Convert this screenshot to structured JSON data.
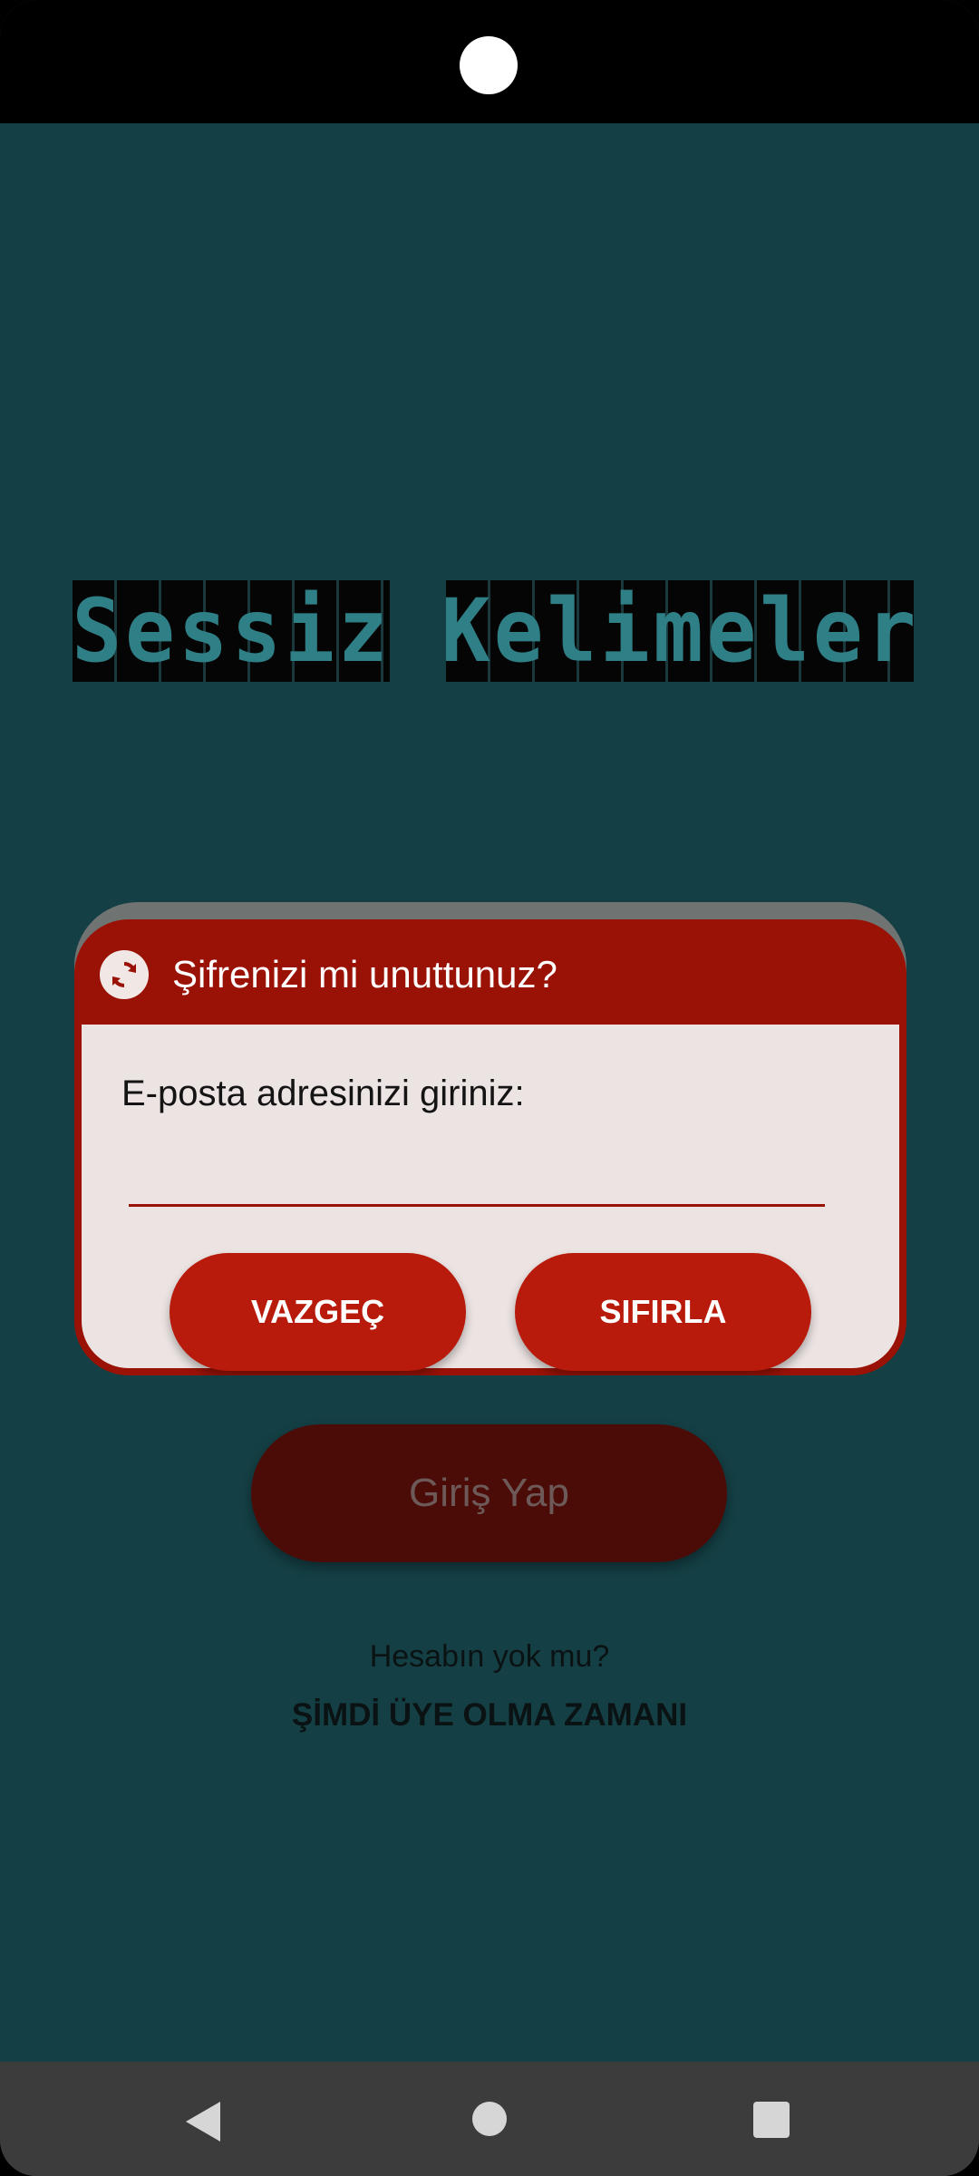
{
  "app": {
    "logo_word_1": "Sessiz",
    "logo_word_2": "Kelimeler"
  },
  "login": {
    "login_button_label": "Giriş Yap",
    "no_account_text": "Hesabın yok mu?",
    "signup_link_label": "ŞİMDİ ÜYE OLMA ZAMANI"
  },
  "dialog": {
    "icon": "refresh-icon",
    "title": "Şifrenizi mi unuttunuz?",
    "prompt": "E-posta adresinizi giriniz:",
    "email_value": "",
    "cancel_label": "VAZGEÇ",
    "reset_label": "SIFIRLA"
  },
  "nav": {
    "back_icon": "back-triangle-icon",
    "home_icon": "home-circle-icon",
    "recents_icon": "recents-square-icon"
  },
  "colors": {
    "background": "#143f44",
    "dialog_header": "#9a1205",
    "dialog_body": "#ece4e3",
    "button_red": "#b81a0b",
    "login_button_dim": "#4b0c08"
  }
}
